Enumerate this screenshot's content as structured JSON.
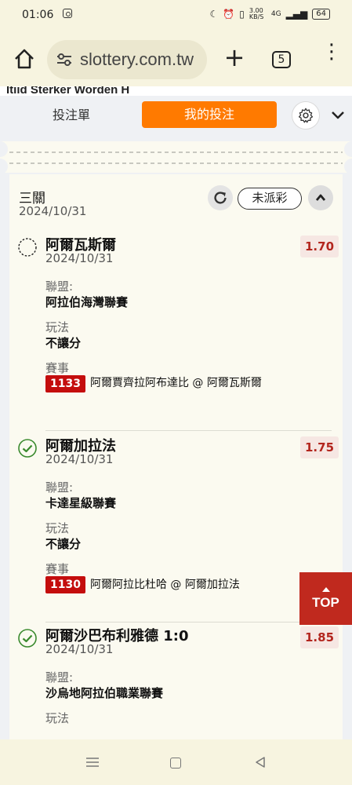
{
  "status_bar": {
    "time": "01:06",
    "net_speed": "3.00 KB/S",
    "network": "4G",
    "battery": "64"
  },
  "browser": {
    "url": "slottery.com.tw",
    "tab_count": "5"
  },
  "page": {
    "peek_text": "Itiid Sterker Worden H",
    "tabs": {
      "bet_slip": "投注單",
      "my_bets": "我的投注"
    },
    "bet": {
      "type": "三關",
      "date": "2024/10/31",
      "status": "未派彩",
      "labels": {
        "league": "聯盟:",
        "play": "玩法",
        "event": "賽事"
      },
      "selections": [
        {
          "state": "pending",
          "team": "阿爾瓦斯爾",
          "date": "2024/10/31",
          "odds": "1.70",
          "league": "阿拉伯海灣聯賽",
          "play": "不讓分",
          "event_id": "1133",
          "event": "阿爾賈齊拉阿布達比 @ 阿爾瓦斯爾"
        },
        {
          "state": "won",
          "team": "阿爾加拉法",
          "date": "2024/10/31",
          "odds": "1.75",
          "league": "卡達星級聯賽",
          "play": "不讓分",
          "event_id": "1130",
          "event": "阿爾阿拉比杜哈 @ 阿爾加拉法"
        },
        {
          "state": "won",
          "team": "阿爾沙巴布利雅德 1:0",
          "date": "2024/10/31",
          "odds": "1.85",
          "league": "沙烏地阿拉伯職業聯賽",
          "play": "玩法"
        }
      ]
    },
    "top_button": "TOP"
  },
  "colors": {
    "accent": "#ff7a00",
    "event_badge": "#c40d0d",
    "odds": "#b3261e",
    "check": "#3a8a2e"
  }
}
